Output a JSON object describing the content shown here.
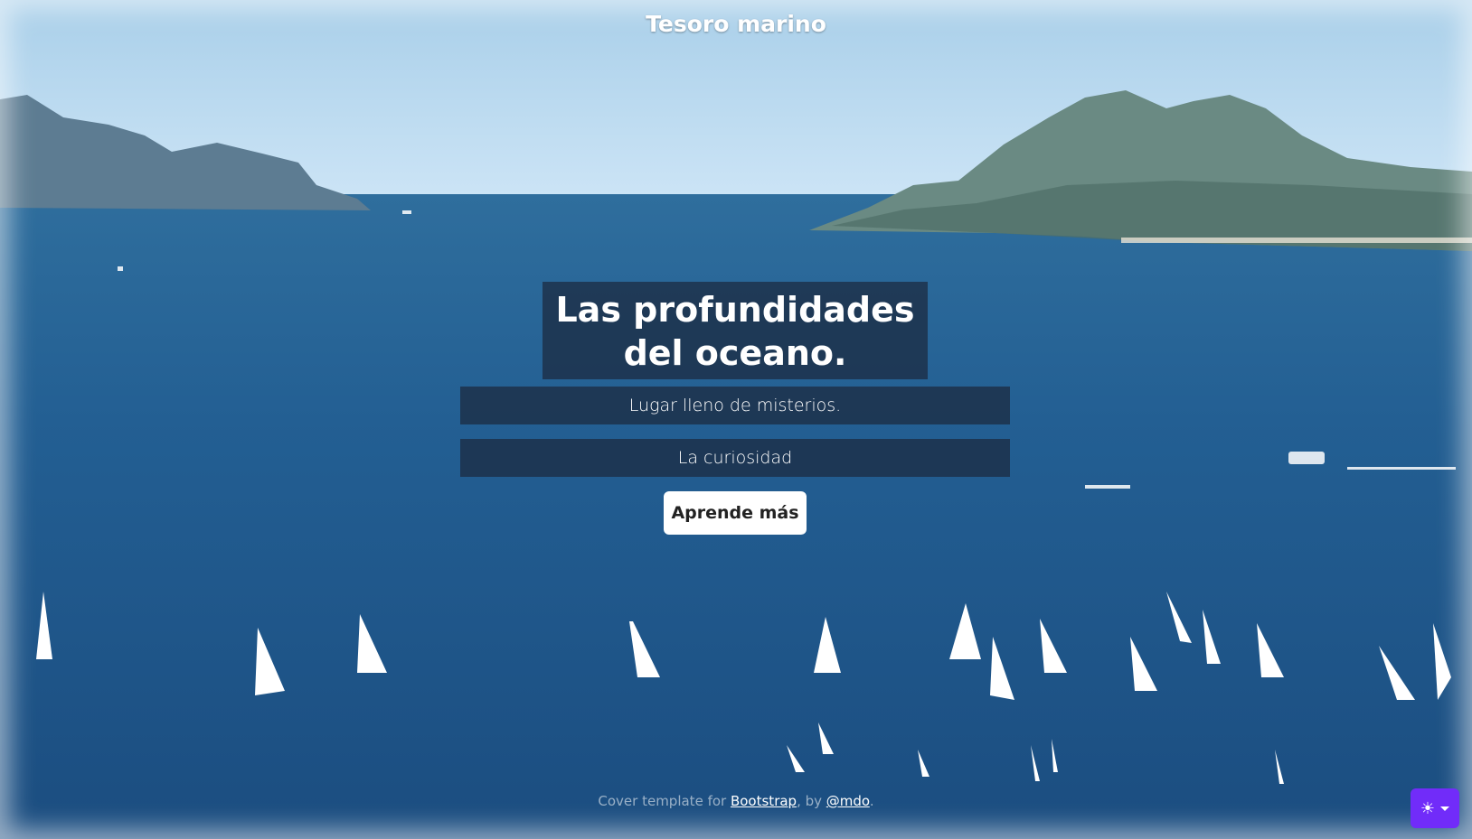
{
  "brand": "Tesoro marino",
  "hero": {
    "title": "Las profundidades del oceano.",
    "lead": "Lugar lleno de misterios.",
    "sub": "La curiosidad",
    "cta_label": "Aprende más"
  },
  "footer": {
    "prefix": "Cover template for ",
    "link1": "Bootstrap",
    "middle": ", by ",
    "link2": "@mdo",
    "suffix": "."
  },
  "theme_toggle": {
    "icon": "sun-icon",
    "glyph": "☀"
  },
  "colors": {
    "sky": "#bcdcf2",
    "sea": "#1f5b8f",
    "accent": "#712cf9"
  }
}
